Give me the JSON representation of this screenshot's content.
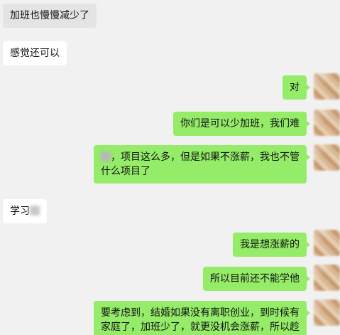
{
  "messages": [
    {
      "side": "in",
      "text": "加班也慢慢减少了"
    },
    {
      "side": "in",
      "text": "感觉还可以"
    },
    {
      "side": "out",
      "text": "对"
    },
    {
      "side": "out",
      "text": "你们是可以少加班，我们难"
    },
    {
      "side": "out",
      "line1": "项目这么多，但是如果不涨薪，我也不管",
      "line2": "什么项目了"
    },
    {
      "side": "in",
      "text": "学习"
    },
    {
      "side": "out",
      "text": "我是想涨薪的"
    },
    {
      "side": "out",
      "text": "所以目前还不能学他"
    },
    {
      "side": "out",
      "line1": "要考虑到，结婚如果没有离职创业，到时候有",
      "line2": "家庭了，加班少了，就更没机会涨薪，所以趁"
    }
  ]
}
